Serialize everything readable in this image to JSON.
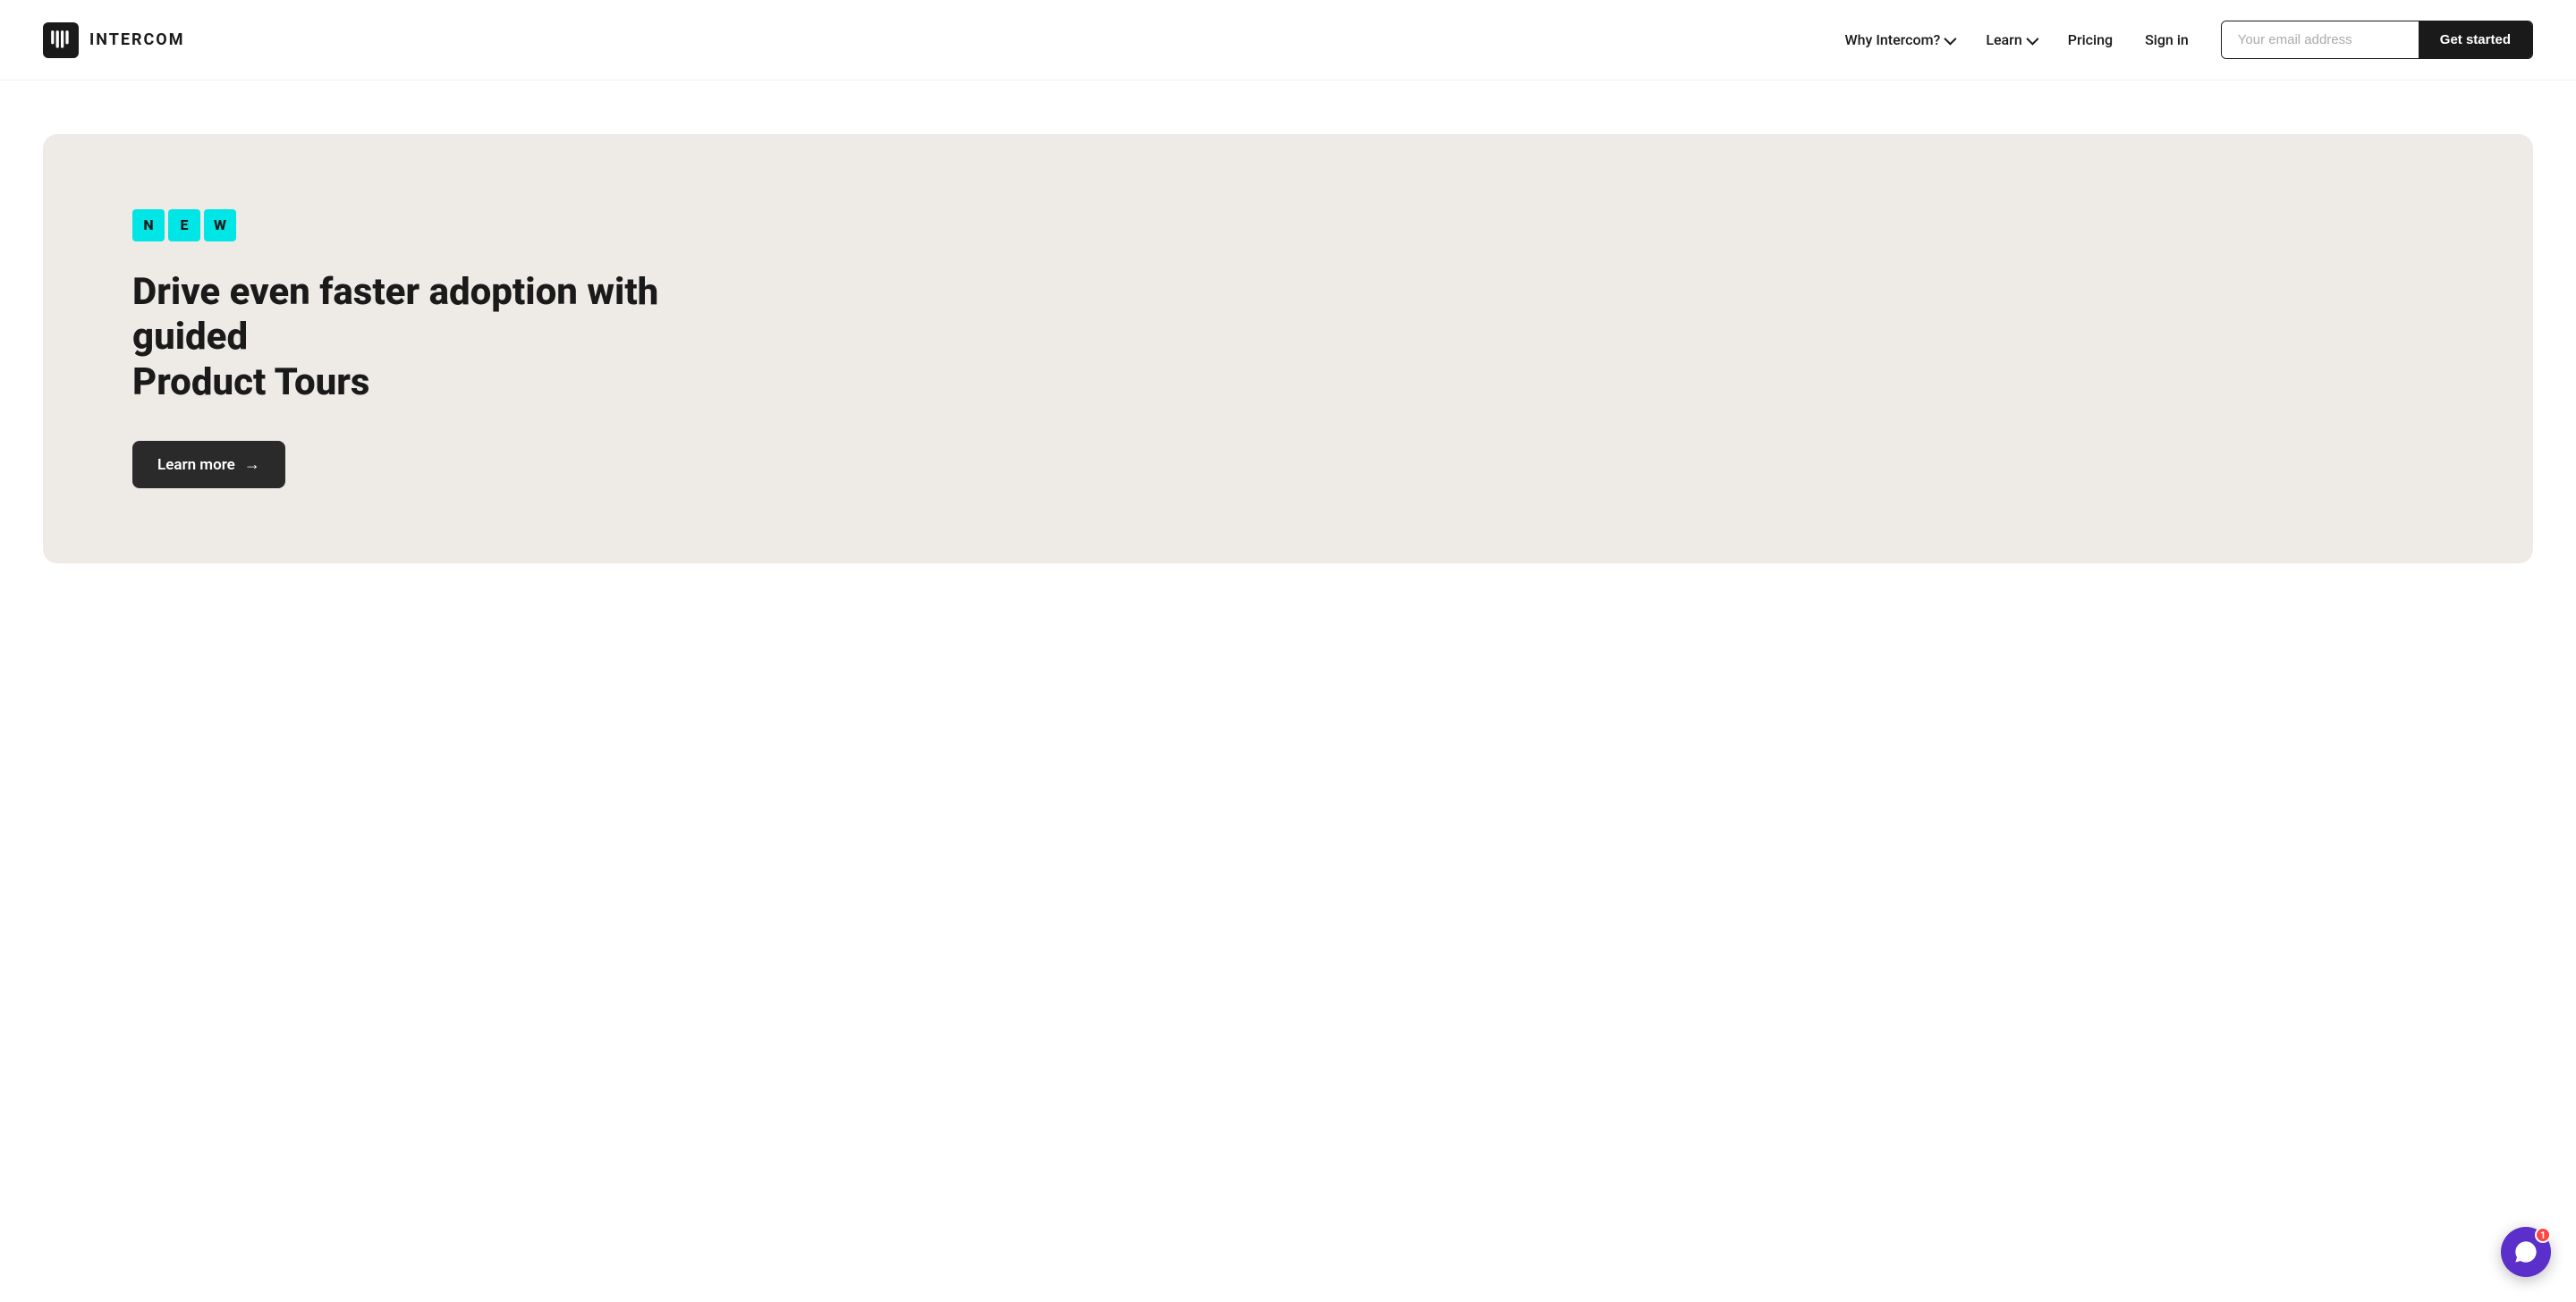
{
  "navbar": {
    "logo_text": "INTERCOM",
    "nav_items": [
      {
        "label": "Why Intercom?",
        "has_dropdown": true
      },
      {
        "label": "Learn",
        "has_dropdown": true
      },
      {
        "label": "Pricing",
        "has_dropdown": false
      },
      {
        "label": "Sign in",
        "has_dropdown": false
      }
    ],
    "email_placeholder": "Your email address",
    "cta_label": "Get started"
  },
  "hero": {
    "badge_letters": [
      "N",
      "E",
      "W"
    ],
    "heading_line1": "Drive even faster adoption with guided",
    "heading_line2": "Product Tours",
    "cta_label": "Learn more",
    "cta_arrow": "→"
  },
  "chat_widget": {
    "notification_count": "1"
  }
}
